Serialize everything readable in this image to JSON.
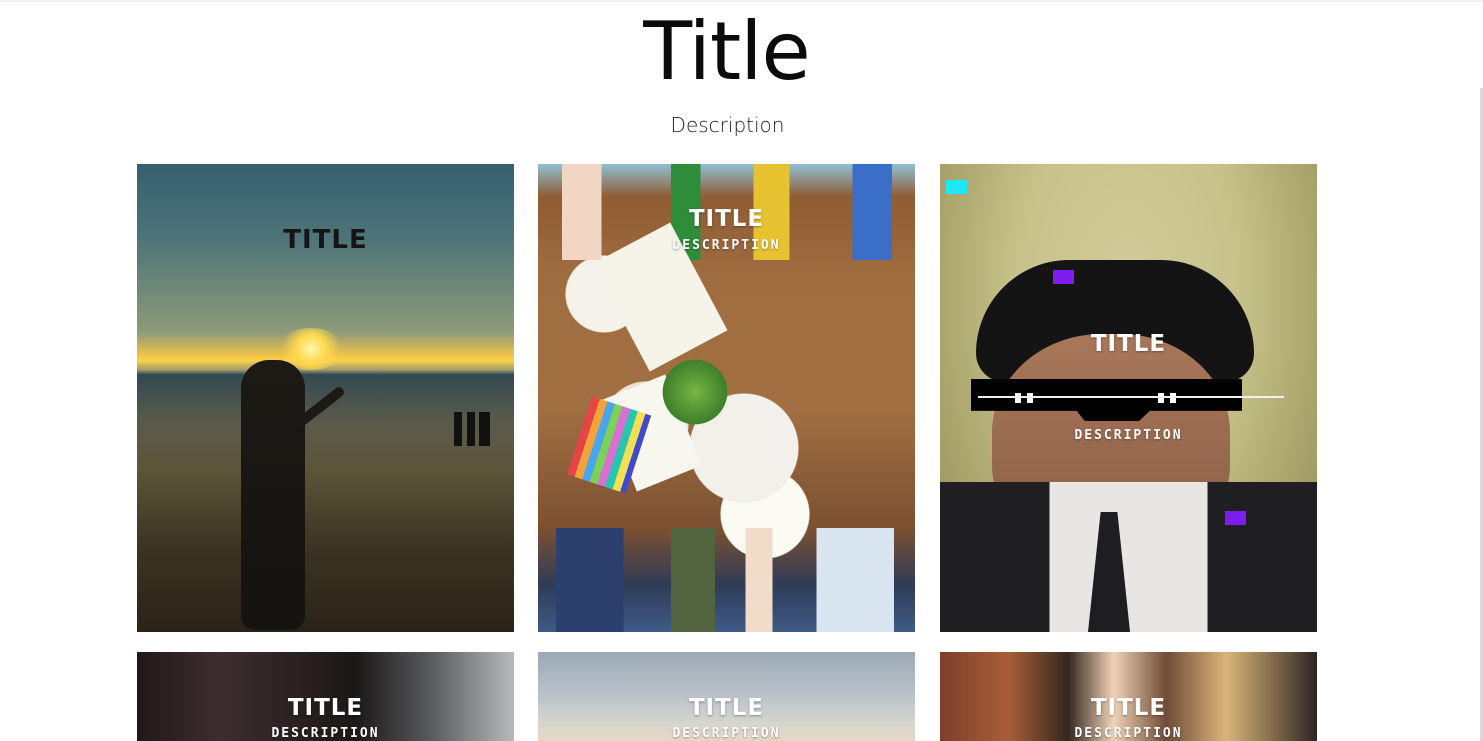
{
  "header": {
    "title": "Title",
    "description": "Description"
  },
  "cards": [
    {
      "title": "TITLE",
      "description": ""
    },
    {
      "title": "TITLE",
      "description": "DESCRIPTION"
    },
    {
      "title": "TITLE",
      "description": "DESCRIPTION"
    },
    {
      "title": "TITLE",
      "description": "DESCRIPTION"
    },
    {
      "title": "TITLE",
      "description": "DESCRIPTION"
    },
    {
      "title": "TITLE",
      "description": "DESCRIPTION"
    }
  ]
}
